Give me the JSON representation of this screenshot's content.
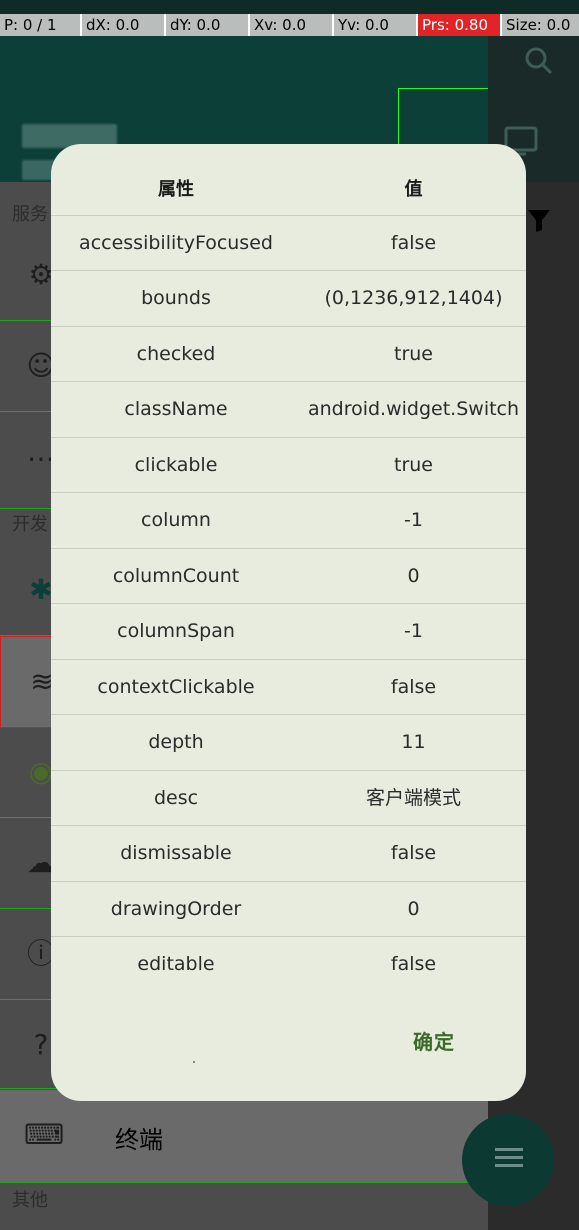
{
  "debug_bar": {
    "pointer": "P: 0 / 1",
    "dx": "dX: 0.0",
    "dy": "dY: 0.0",
    "xv": "Xv: 0.0",
    "yv": "Yv: 0.0",
    "prs": "Prs: 0.80",
    "size": "Size: 0.0"
  },
  "drawer": {
    "section_service": "服务",
    "section_dev": "开发",
    "terminal_label": "终端",
    "section_other": "其他"
  },
  "dialog": {
    "header": {
      "attribute": "属性",
      "value": "值"
    },
    "rows": [
      {
        "key": "accessibilityFocused",
        "value": "false"
      },
      {
        "key": "bounds",
        "value": "(0,1236,912,1404)"
      },
      {
        "key": "checked",
        "value": "true"
      },
      {
        "key": "className",
        "value": "android.widget.Switch"
      },
      {
        "key": "clickable",
        "value": "true"
      },
      {
        "key": "column",
        "value": "-1"
      },
      {
        "key": "columnCount",
        "value": "0"
      },
      {
        "key": "columnSpan",
        "value": "-1"
      },
      {
        "key": "contextClickable",
        "value": "false"
      },
      {
        "key": "depth",
        "value": "11"
      },
      {
        "key": "desc",
        "value": "客户端模式"
      },
      {
        "key": "dismissable",
        "value": "false"
      },
      {
        "key": "drawingOrder",
        "value": "0"
      },
      {
        "key": "editable",
        "value": "false"
      }
    ],
    "confirm": "确定"
  },
  "colors": {
    "accent": "#0b3f37",
    "confirm": "#3b6b2a",
    "dialog_bg": "#e8ecdf",
    "prs_bg": "#e12425"
  }
}
